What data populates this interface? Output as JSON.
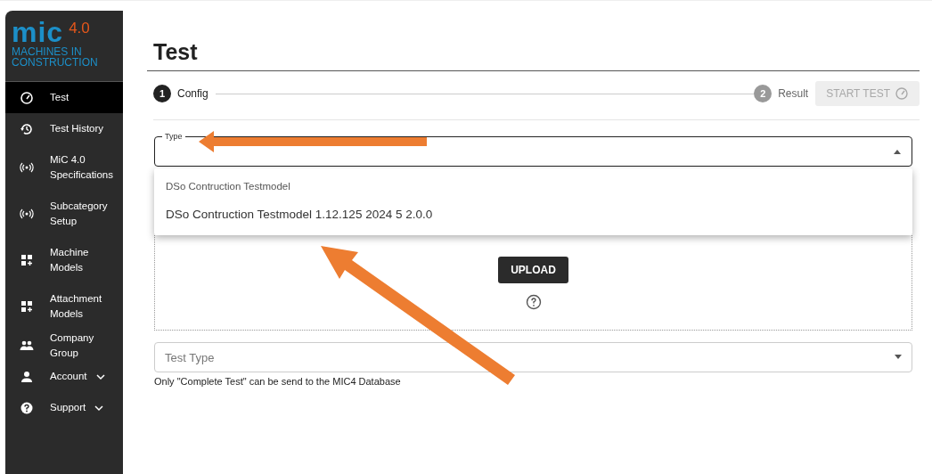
{
  "logo": {
    "mark": "mic",
    "version": "4.0",
    "tagline": "MACHINES IN CONSTRUCTION"
  },
  "sidebar": {
    "items": [
      {
        "label": "Test",
        "selected": true
      },
      {
        "label": "Test History",
        "selected": false
      },
      {
        "label": "MiC 4.0 Specifications",
        "selected": false
      },
      {
        "label": "Subcategory Setup",
        "selected": false
      },
      {
        "label": "Machine Models",
        "selected": false
      },
      {
        "label": "Attachment Models",
        "selected": false
      },
      {
        "label": "Company Group",
        "selected": false
      },
      {
        "label": "Account",
        "selected": false,
        "expandable": true
      },
      {
        "label": "Support",
        "selected": false,
        "expandable": true
      }
    ]
  },
  "page": {
    "title": "Test"
  },
  "stepper": {
    "steps": [
      {
        "number": "1",
        "label": "Config",
        "selected": true
      },
      {
        "number": "2",
        "label": "Result",
        "selected": false
      }
    ],
    "start_button": {
      "label": "START TEST",
      "disabled": true
    }
  },
  "type_field": {
    "label": "Type",
    "expanded": true,
    "menu": [
      {
        "kind": "header",
        "label": "DSo Contruction Testmodel"
      },
      {
        "kind": "option",
        "label": "DSo Contruction Testmodel 1.12.125 2024 5 2.0.0"
      }
    ]
  },
  "upload": {
    "button": "UPLOAD"
  },
  "test_type": {
    "placeholder": "Test Type",
    "helper": "Only \"Complete Test\" can be send to the MIC4 Database"
  }
}
